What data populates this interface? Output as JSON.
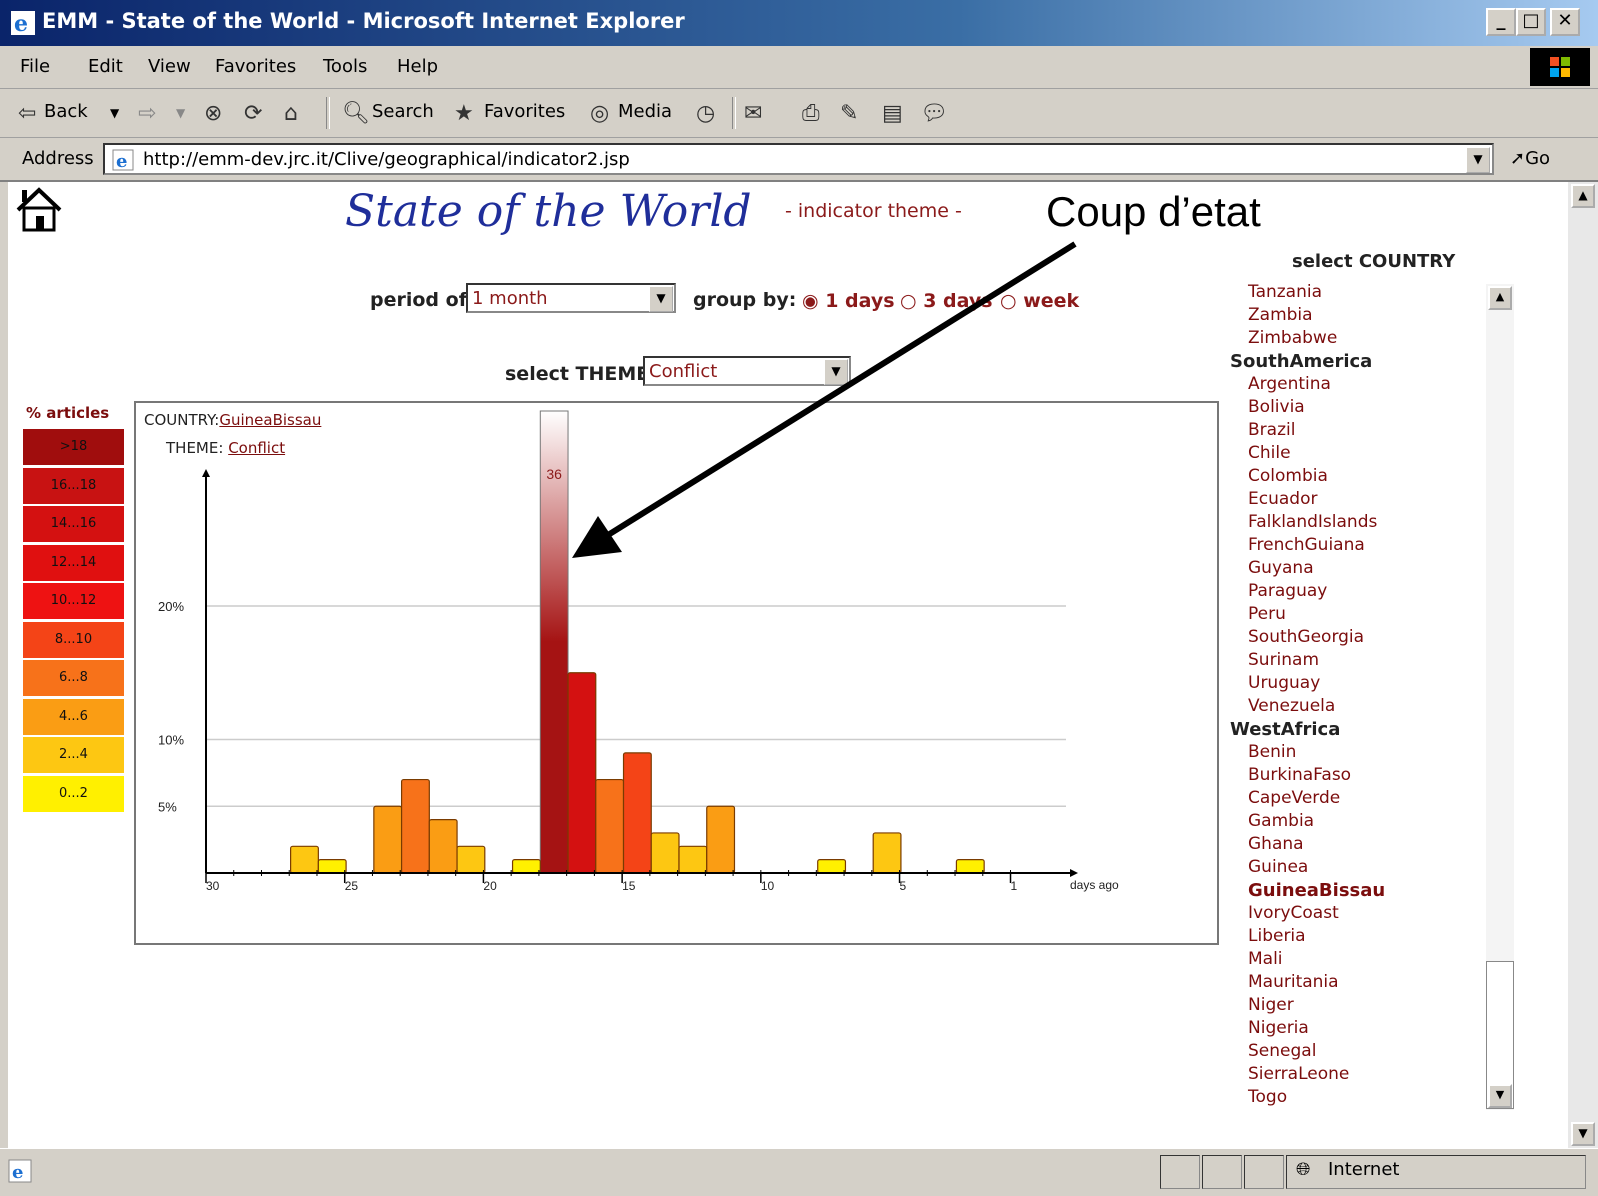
{
  "window": {
    "title": "EMM - State of the World - Microsoft Internet Explorer",
    "menu": [
      "File",
      "Edit",
      "View",
      "Favorites",
      "Tools",
      "Help"
    ],
    "toolbar": {
      "back": "Back",
      "search": "Search",
      "favorites": "Favorites",
      "media": "Media"
    },
    "address_label": "Address",
    "url": "http://emm-dev.jrc.it/Clive/geographical/indicator2.jsp",
    "go": "Go",
    "status_zone": "Internet"
  },
  "page": {
    "title": "State of the World",
    "subtitle": "- indicator theme -",
    "annotation": "Coup d’etat",
    "period_label": "period of:",
    "period_value": "1 month",
    "groupby_label": "group by:",
    "groupby_options": [
      "1 days",
      "3 days",
      "week"
    ],
    "groupby_selected": "1 days",
    "theme_label": "select THEME",
    "theme_value": "Conflict"
  },
  "legend": {
    "title": "% articles",
    "items": [
      {
        "label": ">18",
        "color": "#a00d0d"
      },
      {
        "label": "16...18",
        "color": "#c81212"
      },
      {
        "label": "14...16",
        "color": "#d41111"
      },
      {
        "label": "12...14",
        "color": "#e01010"
      },
      {
        "label": "10...12",
        "color": "#ee1212"
      },
      {
        "label": "8...10",
        "color": "#f44417"
      },
      {
        "label": "6...8",
        "color": "#f7721a"
      },
      {
        "label": "4...6",
        "color": "#fa9d14"
      },
      {
        "label": "2...4",
        "color": "#fdc712"
      },
      {
        "label": "0...2",
        "color": "#fff000"
      }
    ]
  },
  "chart": {
    "country_label": "COUNTRY:",
    "country": "GuineaBissau",
    "theme_label": "THEME:",
    "theme": "Conflict",
    "peak_label": "36",
    "x_unit": "days ago",
    "x_ticks": [
      "30",
      "25",
      "20",
      "15",
      "10",
      "5",
      "1"
    ],
    "y_ticks": [
      "20%",
      "10%",
      "5%"
    ]
  },
  "chart_data": {
    "type": "bar",
    "title": "",
    "xlabel": "days ago",
    "ylabel": "% articles",
    "ylim": [
      0,
      30
    ],
    "x_reversed": true,
    "x_range": [
      30,
      1
    ],
    "x": [
      27,
      26,
      24,
      23,
      22,
      21,
      19,
      18,
      17,
      16,
      15,
      14,
      13,
      12,
      8,
      6,
      3
    ],
    "values": [
      2,
      1,
      5,
      7,
      4,
      2,
      1,
      36,
      15,
      7,
      9,
      3,
      2,
      5,
      1,
      3,
      1
    ],
    "grid": true
  },
  "countries": {
    "select_label": "select COUNTRY",
    "entries": [
      {
        "name": "Tanzania",
        "region": false
      },
      {
        "name": "Zambia",
        "region": false
      },
      {
        "name": "Zimbabwe",
        "region": false
      },
      {
        "name": "SouthAmerica",
        "region": true
      },
      {
        "name": "Argentina",
        "region": false
      },
      {
        "name": "Bolivia",
        "region": false
      },
      {
        "name": "Brazil",
        "region": false
      },
      {
        "name": "Chile",
        "region": false
      },
      {
        "name": "Colombia",
        "region": false
      },
      {
        "name": "Ecuador",
        "region": false
      },
      {
        "name": "FalklandIslands",
        "region": false
      },
      {
        "name": "FrenchGuiana",
        "region": false
      },
      {
        "name": "Guyana",
        "region": false
      },
      {
        "name": "Paraguay",
        "region": false
      },
      {
        "name": "Peru",
        "region": false
      },
      {
        "name": "SouthGeorgia",
        "region": false
      },
      {
        "name": "Surinam",
        "region": false
      },
      {
        "name": "Uruguay",
        "region": false
      },
      {
        "name": "Venezuela",
        "region": false
      },
      {
        "name": "WestAfrica",
        "region": true
      },
      {
        "name": "Benin",
        "region": false
      },
      {
        "name": "BurkinaFaso",
        "region": false
      },
      {
        "name": "CapeVerde",
        "region": false
      },
      {
        "name": "Gambia",
        "region": false
      },
      {
        "name": "Ghana",
        "region": false
      },
      {
        "name": "Guinea",
        "region": false
      },
      {
        "name": "GuineaBissau",
        "region": false,
        "selected": true
      },
      {
        "name": "IvoryCoast",
        "region": false
      },
      {
        "name": "Liberia",
        "region": false
      },
      {
        "name": "Mali",
        "region": false
      },
      {
        "name": "Mauritania",
        "region": false
      },
      {
        "name": "Niger",
        "region": false
      },
      {
        "name": "Nigeria",
        "region": false
      },
      {
        "name": "Senegal",
        "region": false
      },
      {
        "name": "SierraLeone",
        "region": false
      },
      {
        "name": "Togo",
        "region": false
      }
    ]
  }
}
